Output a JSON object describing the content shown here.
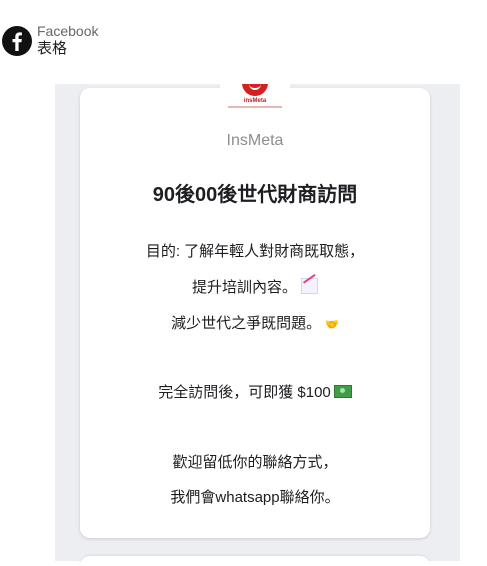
{
  "header": {
    "brand": "Facebook",
    "form_label": "表格",
    "logo_icon": "facebook-icon"
  },
  "card": {
    "logo_text": "insMeta",
    "page_name": "InsMeta",
    "title": "90後00後世代財商訪問",
    "lines": [
      "目的: 了解年輕人對財商既取態，",
      "提升培訓內容。",
      "減少世代之爭既問題。",
      "完全訪問後，可即獲 $100",
      "歡迎留低你的聯絡方式，",
      "我們會whatsapp聯絡你。"
    ],
    "emojis": [
      "chart-increasing-icon",
      "handshake-icon",
      "money-icon"
    ]
  },
  "colors": {
    "facebook_black": "#1c1e21",
    "muted": "#8a8d91",
    "form_background": "#eceef2",
    "logo_red": "#d32020"
  }
}
